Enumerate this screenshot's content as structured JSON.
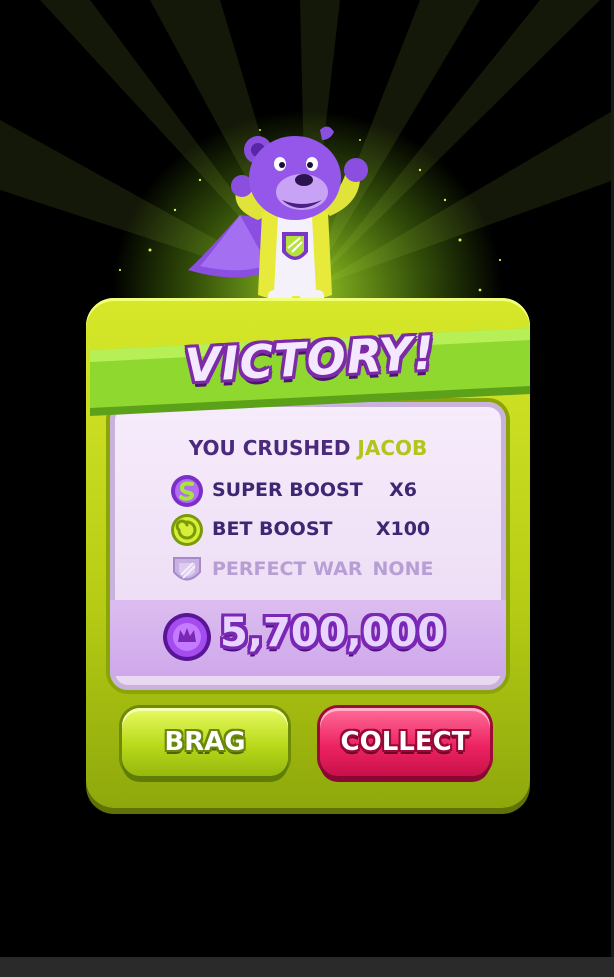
{
  "dialog": {
    "title": "VICTORY!",
    "crushed_prefix": "YOU CRUSHED",
    "opponent_name": "JACOB",
    "rows": [
      {
        "icon": "super-boost-icon",
        "label": "SUPER BOOST",
        "value": "X6"
      },
      {
        "icon": "bet-boost-icon",
        "label": "BET BOOST",
        "value": "X100"
      },
      {
        "icon": "perfect-war-shield-icon",
        "label": "PERFECT WAR",
        "value": "NONE"
      }
    ],
    "reward_amount": "5,700,000",
    "buttons": {
      "brag": "BRAG",
      "collect": "COLLECT"
    }
  },
  "colors": {
    "panel_green": "#c4dc1e",
    "banner_green": "#7fd02a",
    "inner_lavender": "#f3e6fa",
    "reward_purple": "#d2aeea",
    "brag_button": "#c6e023",
    "collect_button": "#ee2462",
    "text_purple": "#3f2673",
    "opponent_lime": "#b3c51a"
  }
}
